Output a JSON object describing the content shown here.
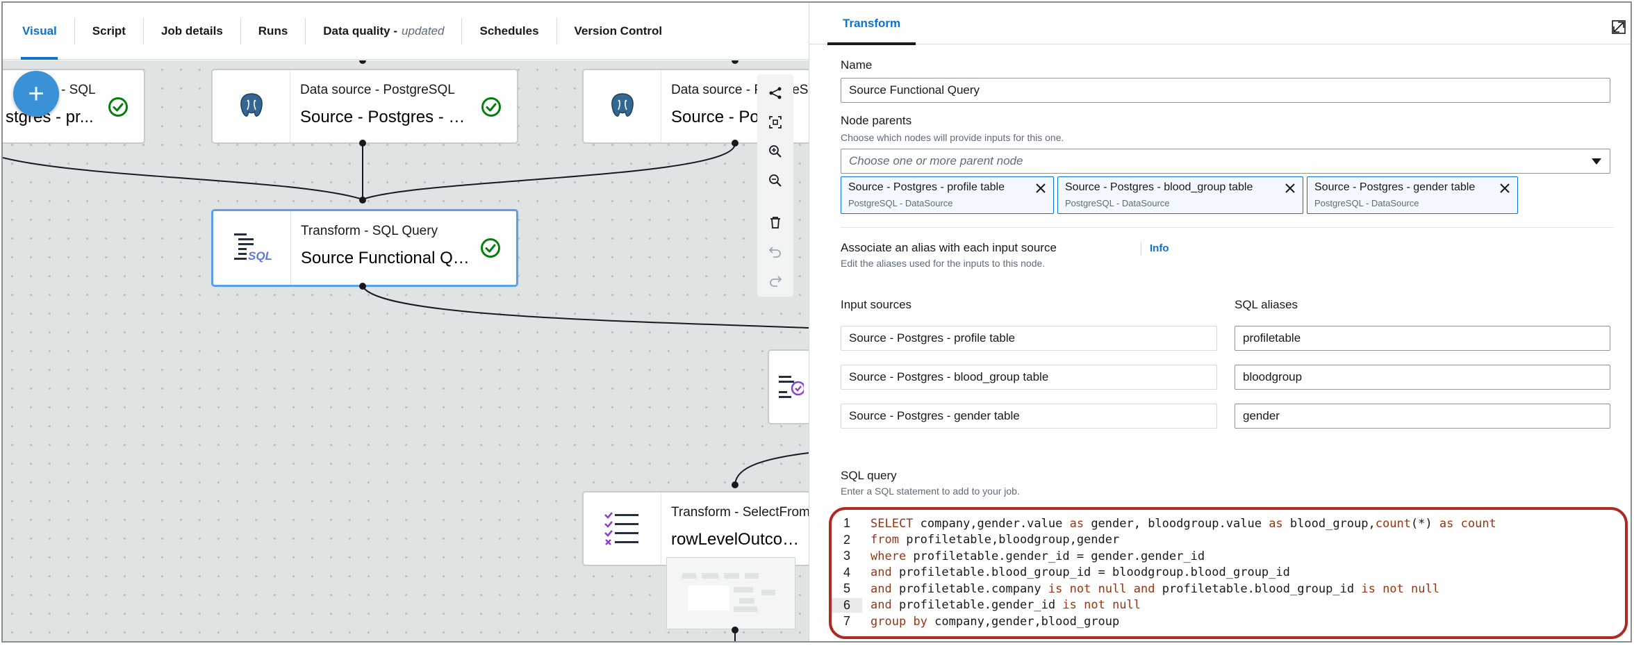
{
  "tabs": [
    {
      "label": "Visual",
      "active": true
    },
    {
      "label": "Script"
    },
    {
      "label": "Job details"
    },
    {
      "label": "Runs"
    },
    {
      "label": "Data quality -",
      "suffix": "updated"
    },
    {
      "label": "Schedules"
    },
    {
      "label": "Version Control"
    }
  ],
  "canvas": {
    "add_button": "+",
    "nodes": [
      {
        "type": "- SQL",
        "name": "stgres - pr...",
        "icon": "postgres-elephant-icon",
        "status": "success"
      },
      {
        "type": "Data source - PostgreSQL",
        "name": "Source - Postgres - bl...",
        "icon": "postgres-elephant-icon",
        "status": "success"
      },
      {
        "type": "Data source - PostgreS",
        "name": "Source - Pos",
        "icon": "postgres-elephant-icon"
      },
      {
        "type": "Transform - SQL Query",
        "name": "Source Functional Qu...",
        "icon": "sql-query-icon",
        "icon_text": "SQL",
        "status": "success",
        "selected": true
      },
      {
        "type": "Transform - SelectFrom",
        "name": "rowLevelOutcomes",
        "icon": "select-from-icon"
      }
    ]
  },
  "panel": {
    "tab": "Transform",
    "name_label": "Name",
    "name_value": "Source Functional Query",
    "parents_label": "Node parents",
    "parents_desc": "Choose which nodes will provide inputs for this one.",
    "parents_placeholder": "Choose one or more parent node",
    "tokens": [
      {
        "label": "Source - Postgres - profile table",
        "sub": "PostgreSQL - DataSource"
      },
      {
        "label": "Source - Postgres - blood_group table",
        "sub": "PostgreSQL - DataSource"
      },
      {
        "label": "Source - Postgres - gender table",
        "sub": "PostgreSQL - DataSource"
      }
    ],
    "alias_label": "Associate an alias with each input source",
    "alias_info": "Info",
    "alias_desc": "Edit the aliases used for the inputs to this node.",
    "input_sources_header": "Input sources",
    "sql_aliases_header": "SQL aliases",
    "rows": [
      {
        "source": "Source - Postgres - profile table",
        "alias": "profiletable"
      },
      {
        "source": "Source - Postgres - blood_group table",
        "alias": "bloodgroup"
      },
      {
        "source": "Source - Postgres - gender table",
        "alias": "gender"
      }
    ],
    "sql_label": "SQL query",
    "sql_desc": "Enter a SQL statement to add to your job.",
    "code_lines": [
      "SELECT company,gender.value as gender, bloodgroup.value as blood_group,count(*) as count",
      "from profiletable,bloodgroup,gender",
      "where profiletable.gender_id = gender.gender_id",
      "and profiletable.blood_group_id = bloodgroup.blood_group_id",
      "and profiletable.company is not null and profiletable.blood_group_id is not null",
      "and profiletable.gender_id is not null",
      "group by company,gender,blood_group"
    ],
    "highlighted_line": 6,
    "colors": {
      "accent": "#0972d3",
      "keyword": "#9a3412",
      "annotation": "#b02a25"
    }
  }
}
